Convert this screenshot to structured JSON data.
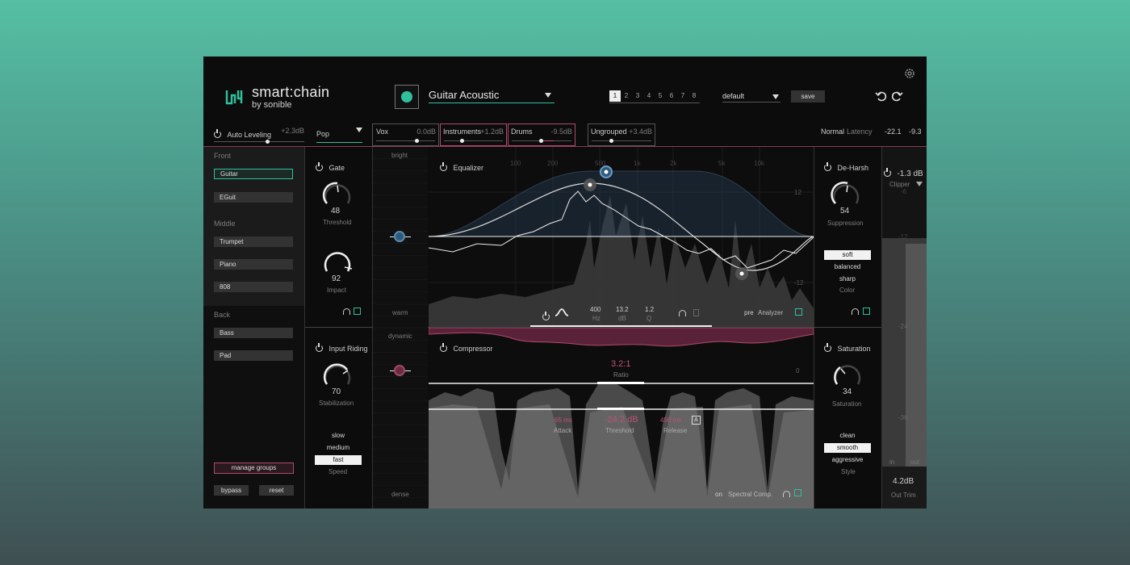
{
  "header": {
    "brand": "smart:chain",
    "brand_sub": "by sonible",
    "preset_name": "Guitar Acoustic",
    "slots": [
      "1",
      "2",
      "3",
      "4",
      "5",
      "6",
      "7",
      "8"
    ],
    "active_slot": "1",
    "profile": "default",
    "save_label": "save"
  },
  "topbar": {
    "auto_leveling_label": "Auto Leveling",
    "auto_leveling_value": "+2.3dB",
    "genre": "Pop",
    "groups": [
      {
        "name": "Vox",
        "value": "0.0dB"
      },
      {
        "name": "Instruments",
        "value": "+1.2dB"
      },
      {
        "name": "Drums",
        "value": "-9.5dB"
      },
      {
        "name": "Ungrouped",
        "value": "+3.4dB"
      }
    ],
    "mode": "Normal",
    "latency_label": "Latency",
    "level_left": "-22.1",
    "level_right": "-9.3"
  },
  "left_panel": {
    "front_label": "Front",
    "front_items": [
      "Guitar",
      "EGuit"
    ],
    "middle_label": "Middle",
    "middle_items": [
      "Trumpet",
      "Piano",
      "808"
    ],
    "back_label": "Back",
    "back_items": [
      "Bass",
      "Pad"
    ],
    "manage_groups": "manage groups",
    "bypass": "bypass",
    "reset": "reset"
  },
  "gate": {
    "title": "Gate",
    "threshold_value": "48",
    "threshold_label": "Threshold",
    "impact_value": "92",
    "impact_label": "Impact"
  },
  "input_riding": {
    "title": "Input Riding",
    "stab_value": "70",
    "stab_label": "Stabilization",
    "speed_options": [
      "slow",
      "medium",
      "fast"
    ],
    "speed_selected": "fast",
    "speed_label": "Speed"
  },
  "tone": {
    "bright": "bright",
    "warm": "warm",
    "dynamic": "dynamic",
    "dense": "dense"
  },
  "equalizer": {
    "title": "Equalizer",
    "freq_ticks": [
      "100",
      "200",
      "500",
      "1k",
      "2k",
      "5k",
      "10k"
    ],
    "db_ticks": [
      "12",
      "0",
      "-12"
    ],
    "band_freq": "400",
    "band_freq_unit": "Hz",
    "band_gain": "13.2",
    "band_gain_unit": "dB",
    "band_q": "1.2",
    "band_q_unit": "Q",
    "analyzer_mode": "pre",
    "analyzer_label": "Analyzer"
  },
  "compressor": {
    "title": "Compressor",
    "ratio_value": "3.2:1",
    "ratio_label": "Ratio",
    "attack_value": "65 ms",
    "attack_label": "Attack",
    "threshold_value": "-24.2 dB",
    "threshold_label": "Threshold",
    "release_value": "450 ms",
    "release_label": "Release",
    "auto_badge": "A",
    "db_ticks": [
      "0",
      "-24",
      "-48"
    ],
    "spectral_state": "on",
    "spectral_label": "Spectral Comp."
  },
  "deharsh": {
    "title": "De-Harsh",
    "suppression_value": "54",
    "suppression_label": "Suppression",
    "color_options": [
      "soft",
      "balanced",
      "sharp"
    ],
    "color_selected": "soft",
    "color_label": "Color"
  },
  "saturation": {
    "title": "Saturation",
    "value": "34",
    "label": "Saturation",
    "style_options": [
      "clean",
      "smooth",
      "aggressive"
    ],
    "style_selected": "smooth",
    "style_label": "Style"
  },
  "output": {
    "clipper_value": "-1.3 dB",
    "clipper_label": "Clipper",
    "scale": [
      "-6",
      "-12",
      "-24",
      "-36",
      "-48"
    ],
    "in_label": "in",
    "out_label": "out",
    "trim_value": "4.2dB",
    "trim_label": "Out Trim"
  },
  "colors": {
    "accent": "#2fbf9c",
    "pink": "#c0507a",
    "eq_blue": "#6a9cc8"
  }
}
